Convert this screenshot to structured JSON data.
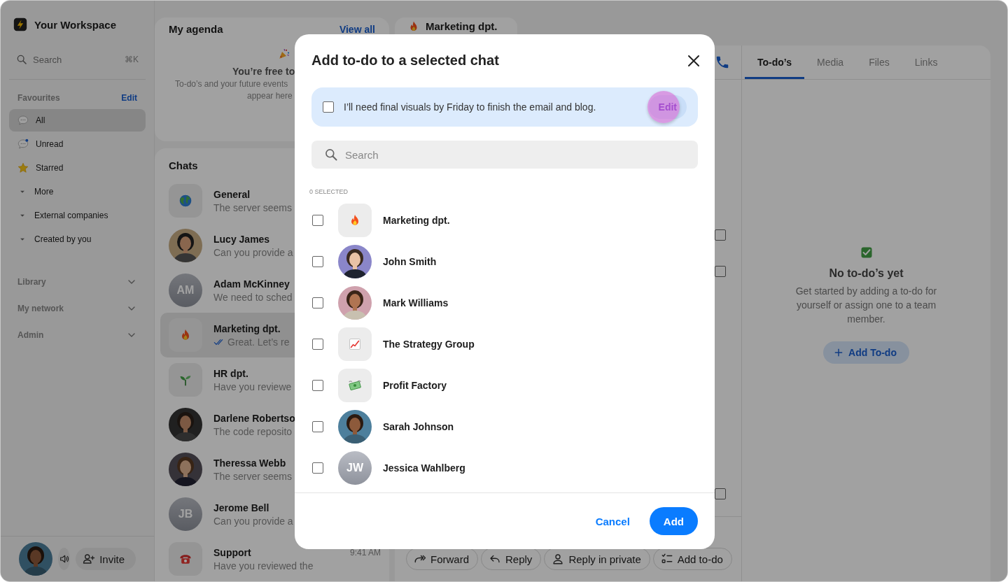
{
  "sidebar": {
    "workspace": "Your Workspace",
    "search": {
      "placeholder": "Search",
      "shortcut": "⌘K"
    },
    "favourites": {
      "title": "Favourites",
      "action": "Edit",
      "items": [
        {
          "label": "All",
          "selected": true
        },
        {
          "label": "Unread",
          "selected": false
        },
        {
          "label": "Starred",
          "selected": false
        },
        {
          "label": "More",
          "selected": false
        },
        {
          "label": "External companies",
          "selected": false
        },
        {
          "label": "Created by you",
          "selected": false
        }
      ]
    },
    "sections": [
      {
        "label": "Library",
        "expanded": false
      },
      {
        "label": "My network",
        "expanded": false
      },
      {
        "label": "Admin",
        "expanded": false
      }
    ],
    "invite": "Invite"
  },
  "agenda": {
    "title": "My agenda",
    "link": "View all",
    "empty_title": "You’re free to",
    "empty_lines": [
      "To-do’s and your future events",
      "appear here"
    ]
  },
  "chats": {
    "title": "Chats",
    "items": [
      {
        "name": "General",
        "preview": "The server seems",
        "avatar": {
          "kind": "emoji"
        },
        "selected": false,
        "read": false
      },
      {
        "name": "Lucy James",
        "preview": "Can you provide a",
        "selected": false,
        "read": false
      },
      {
        "name": "Adam McKinney",
        "preview": "We need to sched",
        "avatar": {
          "kind": "initials",
          "initials": "AM"
        },
        "selected": false,
        "read": false
      },
      {
        "name": "Marketing dpt.",
        "preview": "Great. Let’s re",
        "avatar": {
          "kind": "emoji"
        },
        "selected": true,
        "read": true
      },
      {
        "name": "HR dpt.",
        "preview": "Have you reviewe",
        "avatar": {
          "kind": "emoji"
        },
        "selected": false,
        "read": false
      },
      {
        "name": "Darlene Robertso",
        "preview": "The code reposito",
        "selected": false,
        "read": false
      },
      {
        "name": "Theressa Webb",
        "preview": "The server seems",
        "selected": false,
        "read": false
      },
      {
        "name": "Jerome Bell",
        "preview": "Can you provide a",
        "avatar": {
          "kind": "initials",
          "initials": "JB"
        },
        "selected": false,
        "read": false
      },
      {
        "name": "Support",
        "preview": "Have you reviewed the",
        "time": "9:41 AM",
        "avatar": {
          "kind": "emoji"
        },
        "selected": false,
        "read": false
      }
    ]
  },
  "conversation": {
    "title": "Marketing dpt.",
    "messages": [
      {
        "checked": false
      },
      {
        "checked": false
      },
      {
        "checked": false
      }
    ],
    "actions": [
      {
        "label": "Forward"
      },
      {
        "label": "Reply"
      },
      {
        "label": "Reply in private"
      },
      {
        "label": "Add to-do"
      }
    ]
  },
  "details": {
    "tabs": [
      {
        "label": "To-do’s",
        "selected": true
      },
      {
        "label": "Media",
        "selected": false
      },
      {
        "label": "Files",
        "selected": false
      },
      {
        "label": "Links",
        "selected": false
      }
    ],
    "empty": {
      "title": "No to-do’s yet",
      "text": "Get started by adding a to-do for yourself or assign one to a team member.",
      "button": "Add To-do"
    }
  },
  "modal": {
    "title": "Add to-do to a selected chat",
    "todo": {
      "text": "I’ll need final visuals by Friday to finish the email and blog.",
      "checked": false,
      "action": "Edit",
      "highlighted": true
    },
    "search": {
      "placeholder": "Search"
    },
    "selected_count": "0 SELECTED",
    "items": [
      {
        "name": "Marketing dpt.",
        "avatar": {
          "kind": "emoji"
        },
        "checked": false
      },
      {
        "name": "John Smith",
        "checked": false
      },
      {
        "name": "Mark Williams",
        "checked": false
      },
      {
        "name": "The Strategy Group",
        "avatar": {
          "kind": "emoji"
        },
        "checked": false
      },
      {
        "name": "Profit Factory",
        "avatar": {
          "kind": "emoji"
        },
        "checked": false
      },
      {
        "name": "Sarah Johnson",
        "checked": false
      },
      {
        "name": "Jessica Wahlberg",
        "avatar": {
          "kind": "initials",
          "initials": "JW"
        },
        "checked": false
      }
    ],
    "cancel": "Cancel",
    "confirm": "Add"
  }
}
